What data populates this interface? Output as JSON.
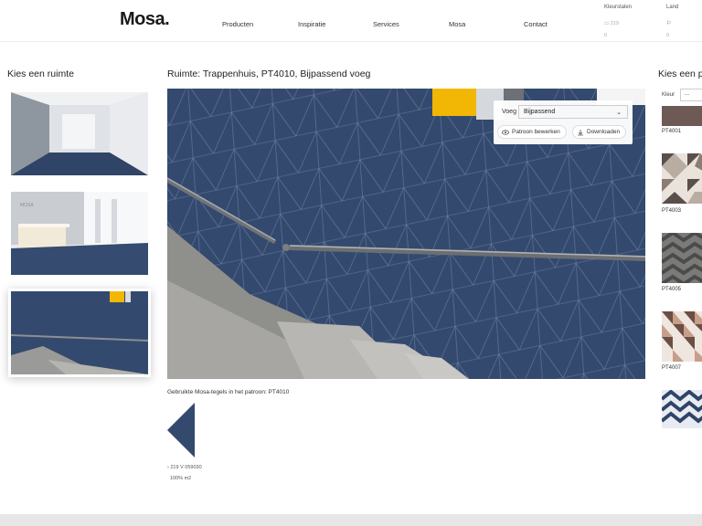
{
  "header": {
    "logo": "Mosa.",
    "nav": [
      {
        "label": "Producten"
      },
      {
        "label": "Inspiratie"
      },
      {
        "label": "Services"
      },
      {
        "label": "Mosa"
      },
      {
        "label": "Contact"
      }
    ],
    "samples_label": "Kleurstalen",
    "samples_count": "0",
    "country_label": "Land",
    "country_value": "0"
  },
  "left": {
    "title": "Kies een ruimte",
    "rooms": [
      {
        "name": "Gang"
      },
      {
        "name": "Receptie"
      },
      {
        "name": "Trappenhuis",
        "active": true
      }
    ]
  },
  "main": {
    "title": "Ruimte: Trappenhuis, PT4010, Bijpassend voeg",
    "voeg_label": "Voeg",
    "voeg_value": "Bijpassend",
    "edit_pattern": "Patroon bewerken",
    "download": "Downloaden",
    "used_tiles_label": "Gebruikte Mosa-tegels in het patroon: PT4010",
    "spec": "219    V 059030",
    "coverage": "100% m2"
  },
  "right": {
    "title": "Kies een p",
    "kleur_label": "Kleur",
    "kleur_value": "...",
    "patterns": [
      {
        "code": "PT4001"
      },
      {
        "code": "PT4003"
      },
      {
        "code": "PT4005"
      },
      {
        "code": "PT4007"
      },
      {
        "code": ""
      }
    ]
  },
  "colors": {
    "tile_blue": "#34496e",
    "accent_yellow": "#f2b705",
    "pattern_brown": "#6e5a55"
  }
}
